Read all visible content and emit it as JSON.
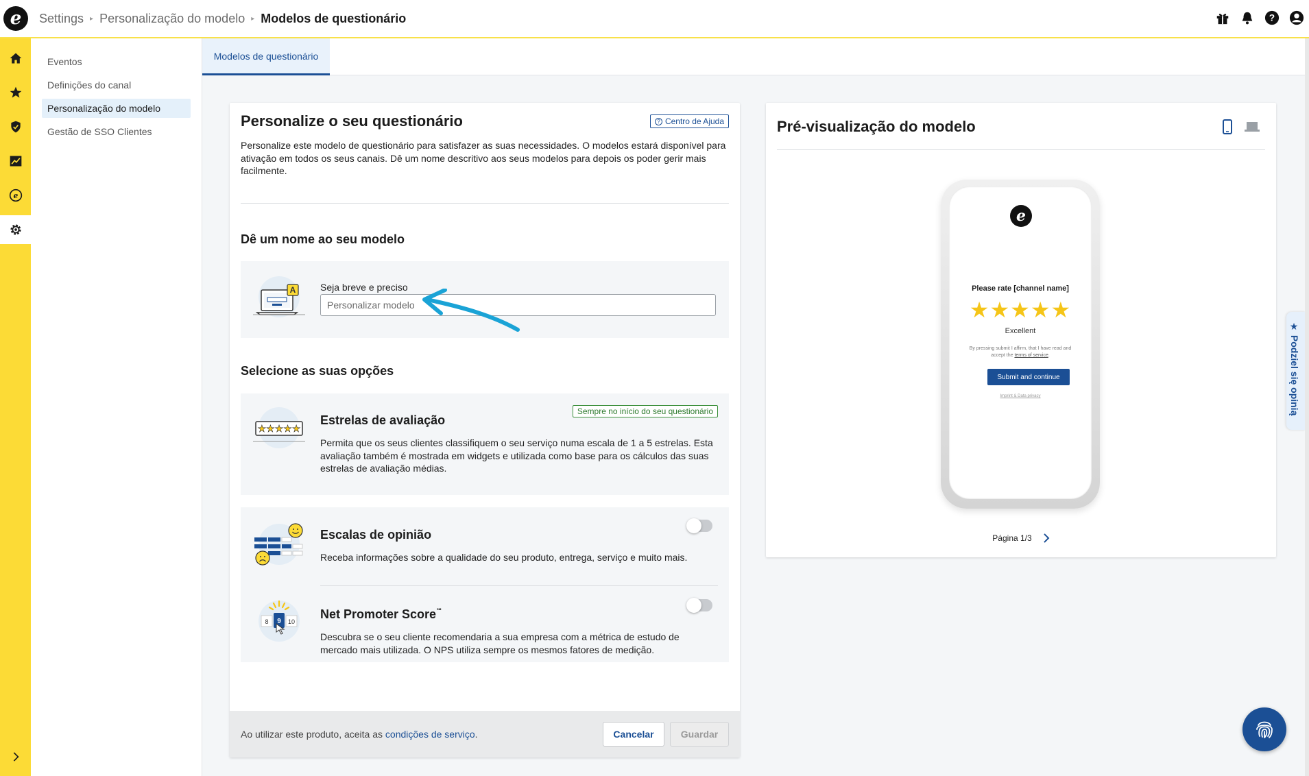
{
  "breadcrumb": [
    "Settings",
    "Personalização do modelo",
    "Modelos de questionário"
  ],
  "top_icons": [
    "gift-icon",
    "bell-icon",
    "help-icon",
    "account-icon"
  ],
  "rail": [
    "home-icon",
    "star-icon",
    "shield-icon",
    "analytics-icon",
    "trustpilot-icon",
    "gear-icon"
  ],
  "subnav": {
    "items": [
      {
        "label": "Eventos",
        "active": false
      },
      {
        "label": "Definições do canal",
        "active": false
      },
      {
        "label": "Personalização do modelo",
        "active": true
      },
      {
        "label": "Gestão de SSO Clientes",
        "active": false
      }
    ]
  },
  "tabs": [
    {
      "label": "Modelos de questionário",
      "active": true
    }
  ],
  "card": {
    "title": "Personalize o seu questionário",
    "help_label": "Centro de Ajuda",
    "description": "Personalize este modelo de questionário para satisfazer as suas necessidades. O modelos estará disponível para ativação em todos os seus canais. Dê um nome descritivo aos seus modelos para depois os poder gerir mais facilmente.",
    "name_section": {
      "title": "Dê um nome ao seu modelo",
      "label": "Seja breve e preciso",
      "placeholder": "Personalizar modelo",
      "value": ""
    },
    "options_section": {
      "title": "Selecione as suas opções",
      "stars": {
        "title": "Estrelas de avaliação",
        "badge": "Sempre no início do seu questionário",
        "description": "Permita que os seus clientes classifiquem o seu serviço numa escala de 1 a 5 estrelas. Esta avaliação também é mostrada em widgets e utilizada como base para os cálculos das suas estrelas de avaliação médias."
      },
      "opinion_scales": {
        "title": "Escalas de opinião",
        "description": "Receba informações sobre a qualidade do seu produto, entrega, serviço e muito mais.",
        "enabled": false
      },
      "nps": {
        "title": "Net Promoter Score",
        "trademark": "℠",
        "description": "Descubra se o seu cliente recomendaria a sua empresa com a métrica de estudo de mercado mais utilizada. O NPS utiliza sempre os mesmos fatores de medição.",
        "enabled": false,
        "scale": [
          "8",
          "9",
          "10"
        ]
      }
    },
    "footer": {
      "text": "Ao utilizar este produto, aceita as ",
      "link": "condições de serviço",
      "suffix": ".",
      "cancel": "Cancelar",
      "save": "Guardar"
    }
  },
  "preview": {
    "title": "Pré-visualização do modelo",
    "device": "mobile",
    "rate_prompt": "Please rate [channel name]",
    "stars": "★★★★★",
    "rating_label": "Excellent",
    "legal_prefix": "By pressing submit I affirm, that I have read and accept the ",
    "legal_link": "terms of service",
    "legal_suffix": ".",
    "submit": "Submit and continue",
    "imprint": "Imprint & Data privacy",
    "pager": "Página 1/3"
  },
  "feedback_tab": "★ Podziel się opinią",
  "colors": {
    "accent": "#1b4f95",
    "rail": "#fcdb36",
    "star": "#f5c518"
  }
}
